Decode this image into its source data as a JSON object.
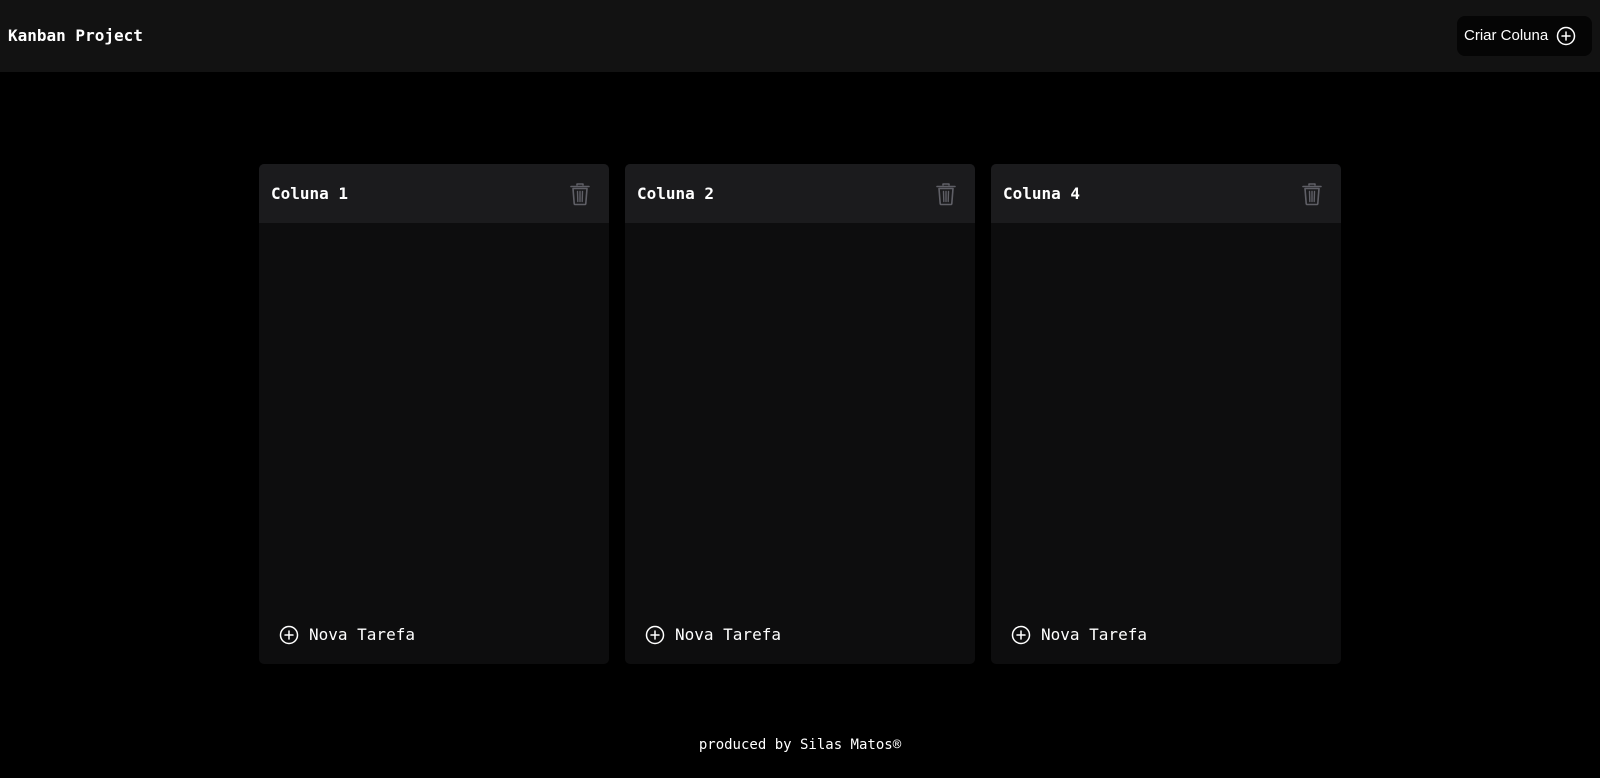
{
  "header": {
    "title": "Kanban Project",
    "create_column_label": "Criar Coluna",
    "create_column_icon": "plus-circle-icon"
  },
  "columns": [
    {
      "title": "Coluna 1",
      "delete_icon": "trash-icon",
      "new_task_label": "Nova Tarefa",
      "new_task_icon": "plus-circle-icon"
    },
    {
      "title": "Coluna 2",
      "delete_icon": "trash-icon",
      "new_task_label": "Nova Tarefa",
      "new_task_icon": "plus-circle-icon"
    },
    {
      "title": "Coluna 4",
      "delete_icon": "trash-icon",
      "new_task_label": "Nova Tarefa",
      "new_task_icon": "plus-circle-icon"
    }
  ],
  "footer": {
    "text": "produced by Silas Matos®"
  },
  "colors": {
    "page_background": "#000000",
    "header_background": "#121212",
    "column_background": "#0d0d0e",
    "column_header_background": "#1b1b1d",
    "trash_icon": "#5f5f66",
    "text": "#ffffff"
  }
}
